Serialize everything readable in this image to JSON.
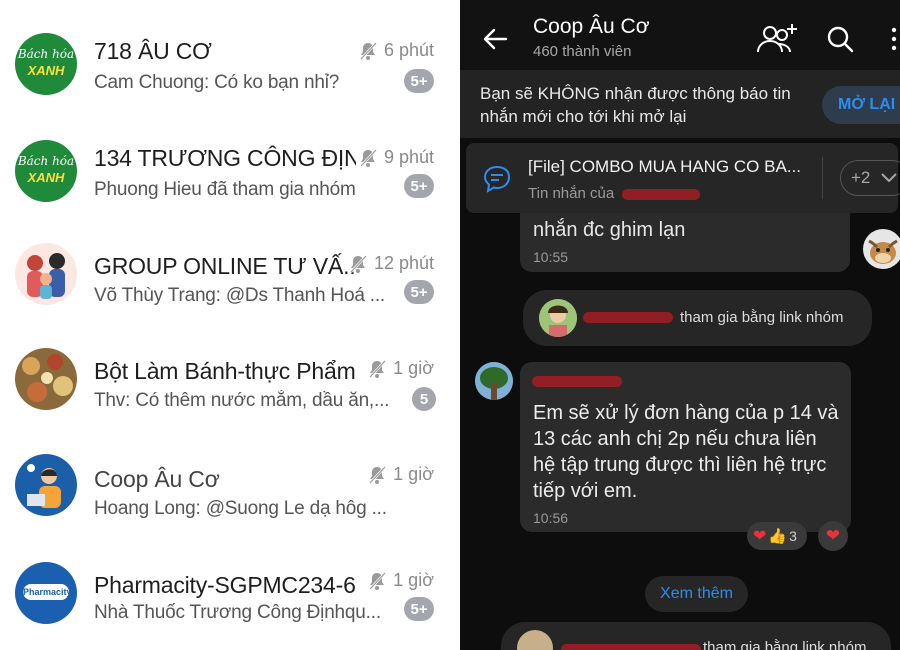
{
  "chat_list": [
    {
      "title": "718 ÂU CƠ",
      "preview": "Cam Chuong: Có ko bạn nhỉ?",
      "time": "6 phút",
      "badge": "5+",
      "avatar_text": [
        "Bách hóa",
        "XANH"
      ],
      "muted": true
    },
    {
      "title": "134 TRƯƠNG CÔNG ĐỊN...",
      "preview": "Phuong Hieu đã tham gia nhóm",
      "time": "9 phút",
      "badge": "5+",
      "avatar_text": [
        "Bách hóa",
        "XANH"
      ],
      "muted": true
    },
    {
      "title": "GROUP ONLINE TƯ VẤ...",
      "preview": "Võ Thùy Trang: @Ds Thanh Hoá ...",
      "time": "12 phút",
      "badge": "5+",
      "muted": true
    },
    {
      "title": "Bột Làm Bánh-thực Phẩm...",
      "preview": "Thv: Có thêm nước mắm, dầu ăn,...",
      "time": "1 giờ",
      "badge": "5",
      "muted": true
    },
    {
      "title": "Coop Âu Cơ",
      "preview": "Hoang Long: @Suong Le dạ hôg ...",
      "time": "1 giờ",
      "badge": "",
      "muted": true
    },
    {
      "title": "Pharmacity-SGPMC234-6...",
      "preview": "Nhà Thuốc Trương Công Địnhqu...",
      "time": "1 giờ",
      "badge": "5+",
      "avatar_text": [
        "Pharmacity"
      ],
      "muted": true
    }
  ],
  "chat": {
    "title": "Coop Âu Cơ",
    "members": "460 thành viên",
    "notice_text": "Bạn sẽ KHÔNG nhận được thông báo tin nhắn mới cho tới khi mở lại",
    "notice_button": "MỞ LẠI",
    "pinned_title": "[File] COMBO MUA HANG CO BA...",
    "pinned_sub": "Tin nhắn của",
    "pinned_more": "+2",
    "msg1_text": "nhắn đc ghim lạn",
    "msg1_time": "10:55",
    "join1_text": "tham gia bằng link nhóm",
    "msg2_text": "Em sẽ xử lý đơn hàng của p 14 và 13 các anh chị 2p nếu chưa liên hệ tập trung được thì liên hệ trực tiếp với em.",
    "msg2_time": "10:56",
    "reaction_count": "3",
    "see_more": "Xem thêm",
    "join2_text": "tham gia bằng link nhóm",
    "colors": {
      "accent": "#2e8cf0",
      "badge": "#a3a7ad",
      "dark_bg": "#0d0d0d"
    }
  }
}
